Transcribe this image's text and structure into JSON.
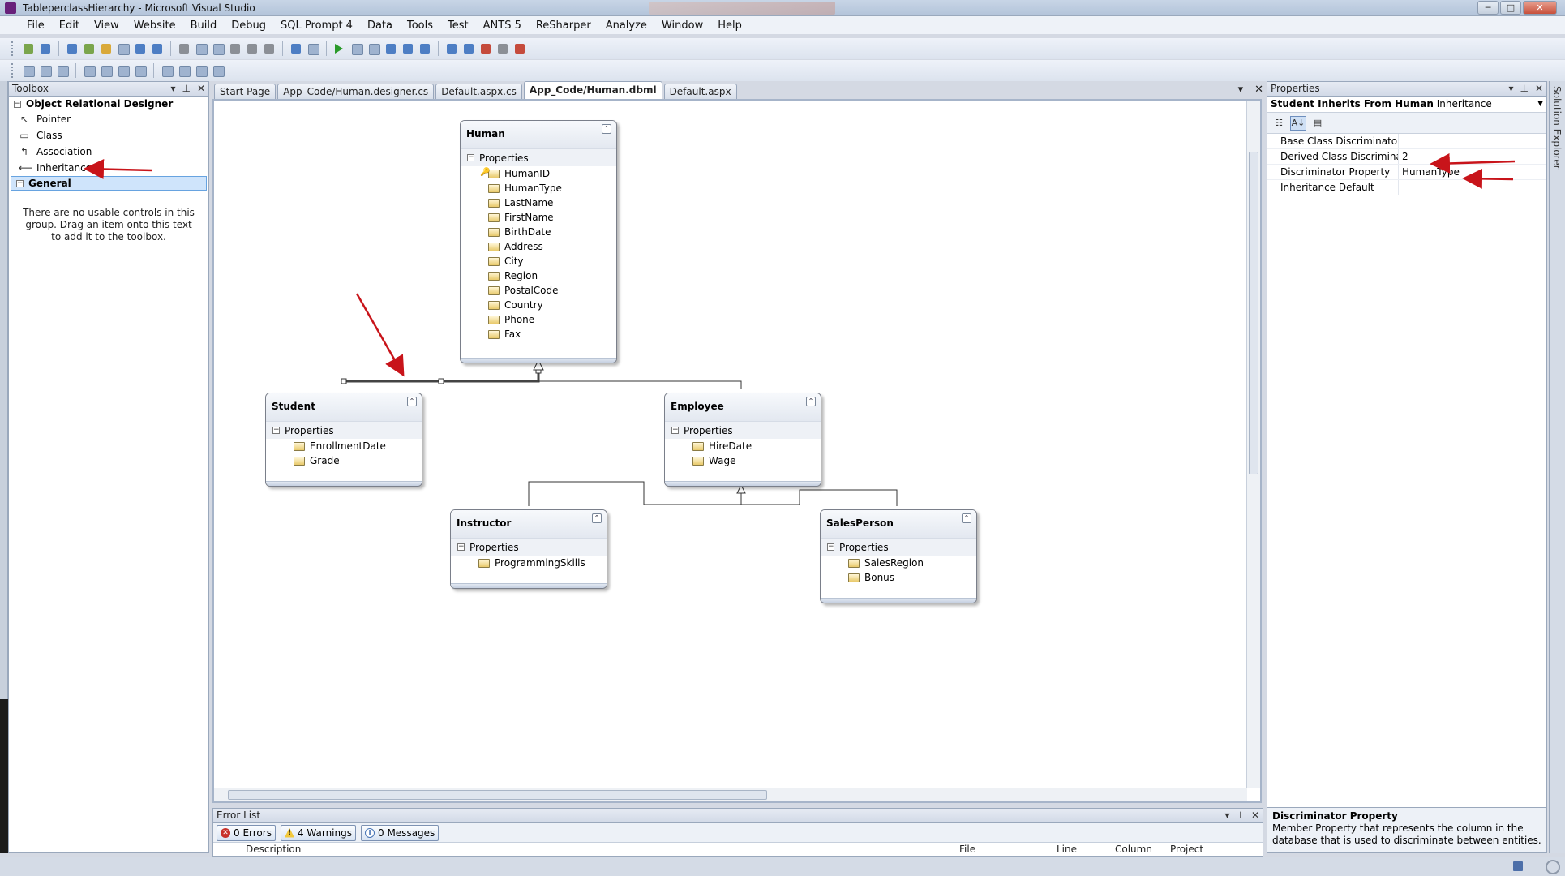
{
  "window": {
    "title": "TableperclassHierarchy - Microsoft Visual Studio",
    "minimize": "─",
    "maximize": "□",
    "close": "✕"
  },
  "menu": [
    "File",
    "Edit",
    "View",
    "Website",
    "Build",
    "Debug",
    "SQL Prompt 4",
    "Data",
    "Tools",
    "Test",
    "ANTS 5",
    "ReSharper",
    "Analyze",
    "Window",
    "Help"
  ],
  "toolbox": {
    "title": "Toolbox",
    "controls": {
      "dropdown": "▾",
      "pin": "⊥",
      "close": "✕"
    },
    "group_designer": "Object Relational Designer",
    "items": [
      {
        "label": "Pointer",
        "icon": "↖"
      },
      {
        "label": "Class",
        "icon": "▭"
      },
      {
        "label": "Association",
        "icon": "↰"
      },
      {
        "label": "Inheritance",
        "icon": "⟵"
      }
    ],
    "group_general": "General",
    "empty_text": "There are no usable controls in this group. Drag an item onto this text to add it to the toolbox."
  },
  "doc_tabs": [
    {
      "label": "Start Page",
      "active": false
    },
    {
      "label": "App_Code/Human.designer.cs",
      "active": false
    },
    {
      "label": "Default.aspx.cs",
      "active": false
    },
    {
      "label": "App_Code/Human.dbml",
      "active": true
    },
    {
      "label": "Default.aspx",
      "active": false
    }
  ],
  "doc_tab_controls": {
    "dropdown": "▾",
    "close": "✕"
  },
  "entities": {
    "human": {
      "name": "Human",
      "section": "Properties",
      "props": [
        "HumanID",
        "HumanType",
        "LastName",
        "FirstName",
        "BirthDate",
        "Address",
        "City",
        "Region",
        "PostalCode",
        "Country",
        "Phone",
        "Fax"
      ],
      "key_prop": "HumanID"
    },
    "student": {
      "name": "Student",
      "section": "Properties",
      "props": [
        "EnrollmentDate",
        "Grade"
      ]
    },
    "employee": {
      "name": "Employee",
      "section": "Properties",
      "props": [
        "HireDate",
        "Wage"
      ]
    },
    "instructor": {
      "name": "Instructor",
      "section": "Properties",
      "props": [
        "ProgrammingSkills"
      ]
    },
    "salesperson": {
      "name": "SalesPerson",
      "section": "Properties",
      "props": [
        "SalesRegion",
        "Bonus"
      ]
    }
  },
  "error_list": {
    "title": "Error List",
    "errors": "0 Errors",
    "warnings": "4 Warnings",
    "messages": "0 Messages",
    "columns": [
      "Description",
      "File",
      "Line",
      "Column",
      "Project"
    ]
  },
  "properties": {
    "title": "Properties",
    "object_name": "Student Inherits From Human",
    "object_type": "Inheritance",
    "rows": [
      {
        "name": "Base Class Discriminator Va",
        "value": ""
      },
      {
        "name": "Derived Class Discriminator",
        "value": "2"
      },
      {
        "name": "Discriminator Property",
        "value": "HumanType"
      },
      {
        "name": "Inheritance Default",
        "value": ""
      }
    ],
    "desc_title": "Discriminator Property",
    "desc_text": "Member Property that represents the column in the database that is used to discriminate between entities."
  },
  "side_tab": "Solution Explorer",
  "colors": {
    "annotation_arrow": "#c8141a",
    "accent": "#3f6fb5"
  }
}
